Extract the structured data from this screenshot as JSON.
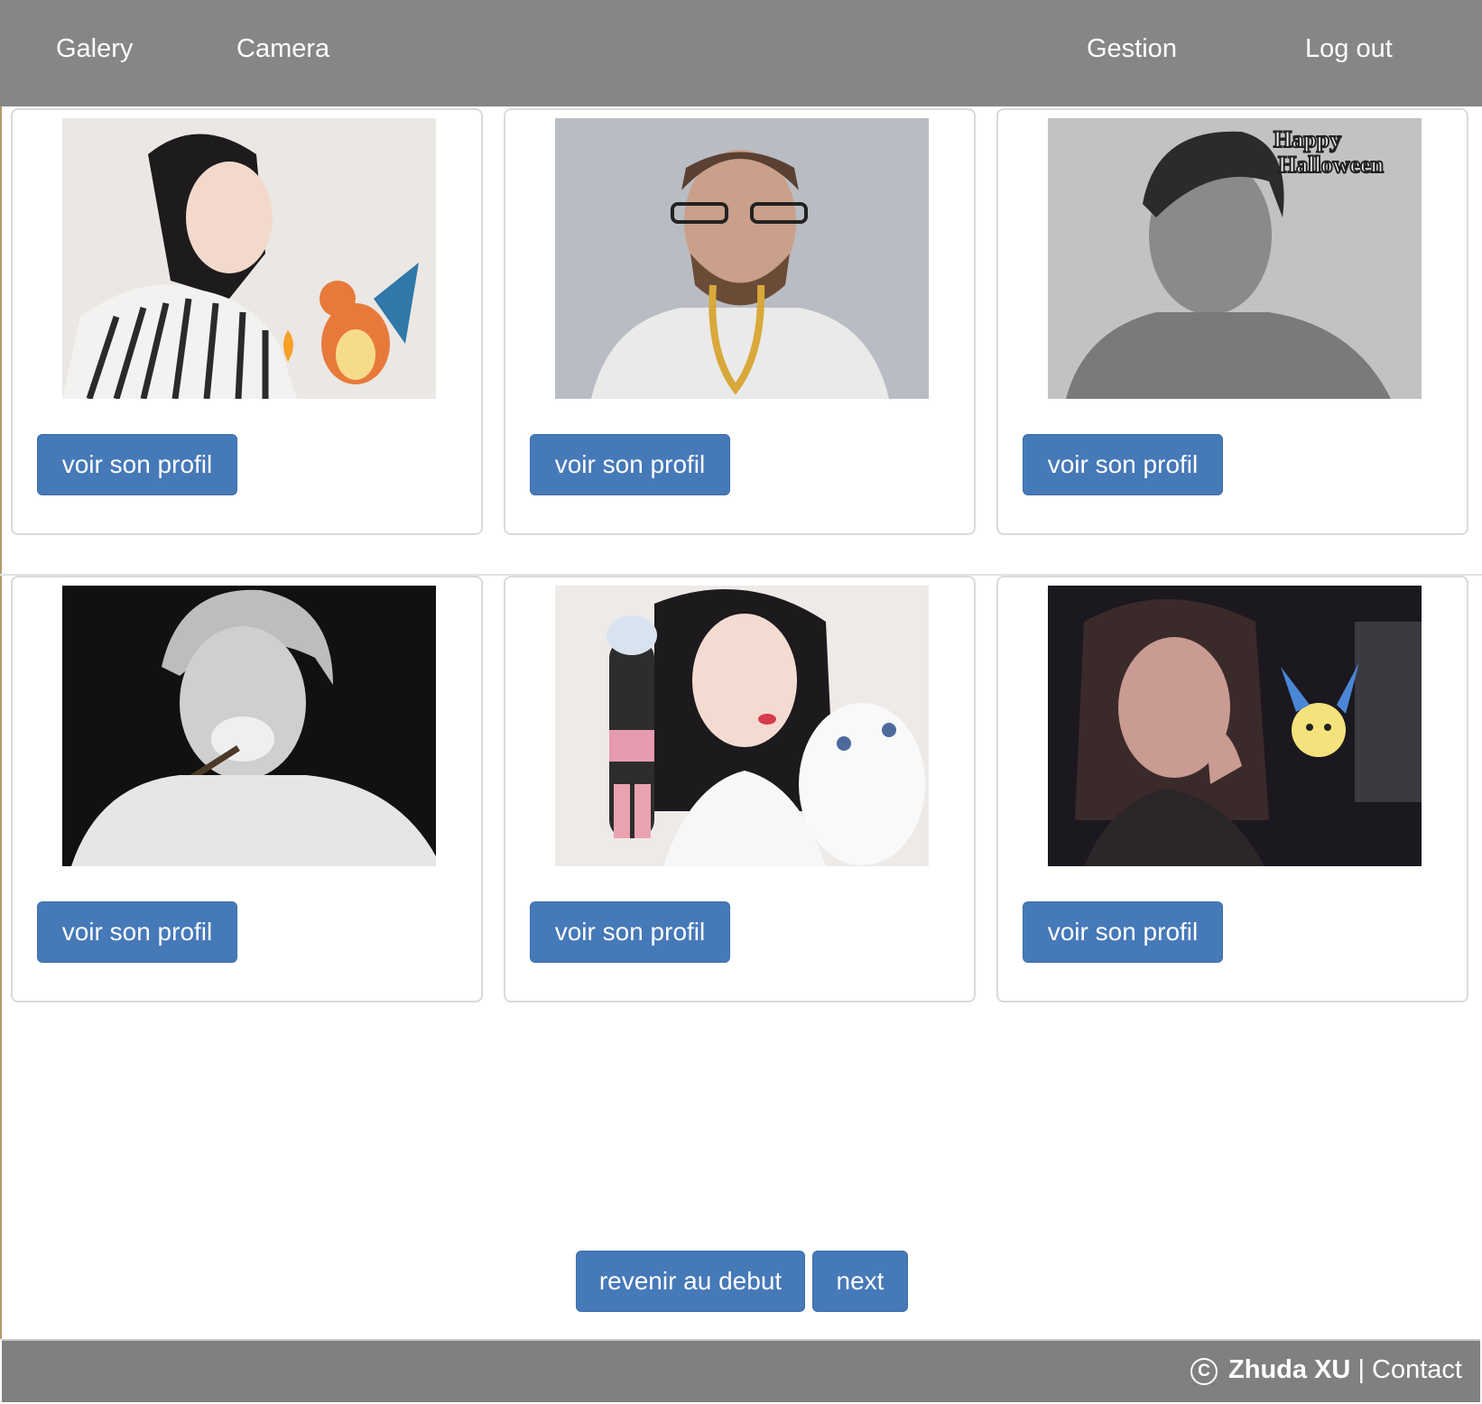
{
  "navbar": {
    "galery": "Galery",
    "camera": "Camera",
    "gestion": "Gestion",
    "logout": "Log out"
  },
  "gallery": {
    "button_label": "voir son profil",
    "items": [
      {
        "photo": "woman-with-dragon-sticker"
      },
      {
        "photo": "man-with-gold-chain-sticker"
      },
      {
        "photo": "man-with-halloween-sticker"
      },
      {
        "photo": "man-smoking"
      },
      {
        "photo": "woman-with-anime-character-sticker"
      },
      {
        "photo": "woman-with-yellow-creature-sticker"
      }
    ]
  },
  "sticker_text": {
    "happy": "Happy",
    "halloween": "Halloween"
  },
  "pagination": {
    "start": "revenir au debut",
    "next": "next"
  },
  "footer": {
    "copyright_symbol": "C",
    "author": "Zhuda XU",
    "separator": "|",
    "contact": "Contact"
  },
  "colors": {
    "navbar": "#868686",
    "button": "#4679b8",
    "footer": "#808080"
  }
}
